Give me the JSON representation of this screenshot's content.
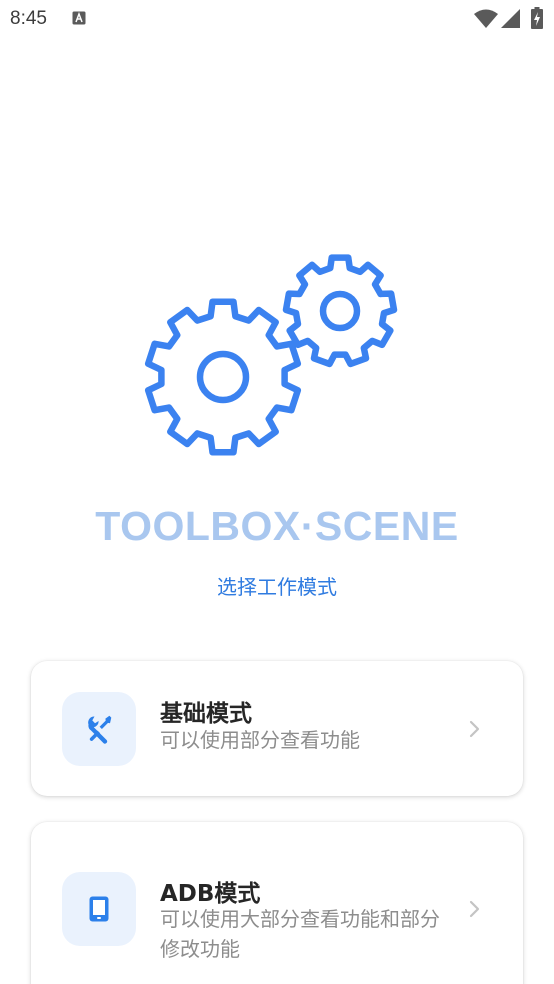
{
  "status_bar": {
    "time": "8:45",
    "icons": [
      "a-notification-icon",
      "wifi-icon",
      "signal-icon",
      "battery-charging-icon"
    ]
  },
  "logo": {
    "icon": "gears-icon",
    "color": "#3b82f0"
  },
  "app_title": "TOOLBOX·SCENE",
  "subtitle": "选择工作模式",
  "modes": [
    {
      "title": "基础模式",
      "description": "可以使用部分查看功能",
      "icon": "wrench-screwdriver-icon"
    },
    {
      "title": "ADB模式",
      "description": "可以使用大部分查看功能和部分修改功能",
      "icon": "phone-icon"
    }
  ],
  "colors": {
    "accent": "#3b82f0",
    "title": "#a9c7ef",
    "subtitle": "#2f7be0",
    "icon_bg": "#eaf2fd",
    "card_title": "#262626",
    "card_desc": "#8d8d8d"
  }
}
